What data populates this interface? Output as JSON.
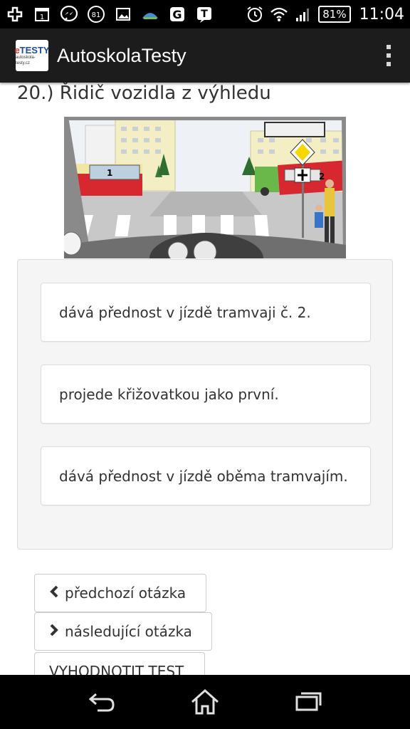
{
  "status_bar": {
    "notification_count": "1",
    "badge_value": "81",
    "battery": "81%",
    "time": "11:04"
  },
  "app_bar": {
    "logo_main": "eTESTY",
    "logo_sub": "autoskola-testy.cz",
    "title": "AutoskolaTesty"
  },
  "question": {
    "title": "20.) Řidič vozidla z výhledu",
    "image_labels": [
      "1",
      "2"
    ]
  },
  "answers": [
    {
      "text": "dává přednost v jízdě tramvaji č. 2."
    },
    {
      "text": "projede křižovatkou jako první."
    },
    {
      "text": "dává přednost v jízdě oběma tramvajím."
    }
  ],
  "navigation": {
    "prev_label": "předchozí otázka",
    "next_label": "následující otázka",
    "evaluate_label": "VYHODNOTIT TEST"
  },
  "colors": {
    "appbar_bg": "#1c1c1c",
    "tram_red": "#d7282f",
    "sign_yellow": "#f5d800"
  }
}
